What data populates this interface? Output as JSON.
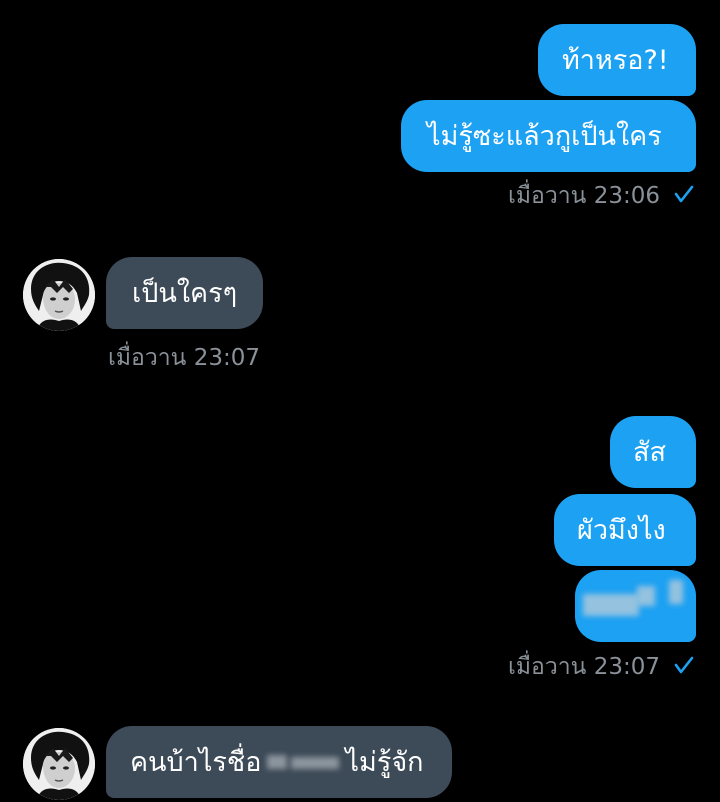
{
  "accent_color": "#1da1f2",
  "incoming_color": "#3d4a57",
  "messages": {
    "out1": {
      "text": "ท้าหรอ?!"
    },
    "out2": {
      "text": "ไม่รู้ซะแล้วกูเป็นใคร"
    },
    "meta1": {
      "time": "เมื่อวาน 23:06",
      "status_icon": "check-icon"
    },
    "in1": {
      "text": "เป็นใครๆ",
      "avatar_icon": "avatar"
    },
    "meta2": {
      "time": "เมื่อวาน 23:07"
    },
    "out3": {
      "text": "สัส"
    },
    "out4": {
      "text": "ผัวมึงไง"
    },
    "out5": {
      "blurred": true
    },
    "meta3": {
      "time": "เมื่อวาน 23:07",
      "status_icon": "check-icon"
    },
    "in2": {
      "text_before": "คนบ้าไรชื่อ",
      "text_after": "ไม่รู้จัก",
      "avatar_icon": "avatar"
    }
  }
}
